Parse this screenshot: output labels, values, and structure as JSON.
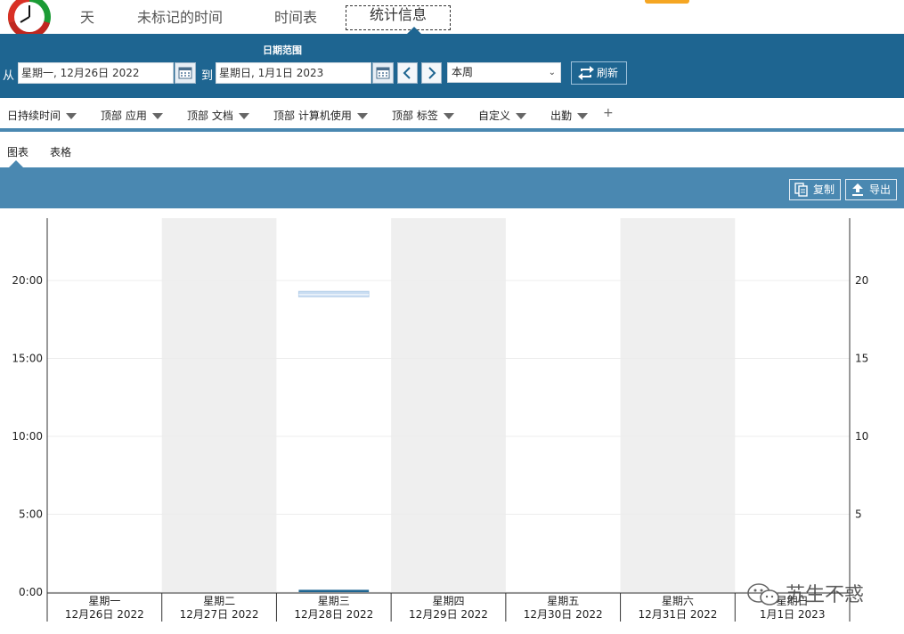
{
  "top_tabs": [
    {
      "label": "天"
    },
    {
      "label": "未标记的时间"
    },
    {
      "label": "时间表"
    },
    {
      "label": "统计信息",
      "active": true
    }
  ],
  "range": {
    "title": "日期范围",
    "from_label": "从",
    "from_value": "星期一, 12月26日 2022",
    "to_label": "到",
    "to_value": "星期日, 1月1日 2023",
    "period": "本周",
    "refresh_label": "刷新"
  },
  "report_tabs": [
    {
      "label": "日持续时间"
    },
    {
      "label": "顶部 应用"
    },
    {
      "label": "顶部 文档"
    },
    {
      "label": "顶部 计算机使用"
    },
    {
      "label": "顶部 标签"
    },
    {
      "label": "自定义"
    },
    {
      "label": "出勤"
    }
  ],
  "view_tabs": [
    {
      "label": "图表",
      "active": true
    },
    {
      "label": "表格"
    }
  ],
  "toolbar": {
    "copy_label": "复制",
    "export_label": "导出"
  },
  "watermark": "苏生不惑",
  "chart_data": {
    "type": "bar",
    "categories": [
      {
        "day": "星期一",
        "date": "12月26日 2022"
      },
      {
        "day": "星期二",
        "date": "12月27日 2022"
      },
      {
        "day": "星期三",
        "date": "12月28日 2022"
      },
      {
        "day": "星期四",
        "date": "12月29日 2022"
      },
      {
        "day": "星期五",
        "date": "12月30日 2022"
      },
      {
        "day": "星期六",
        "date": "12月31日 2022"
      },
      {
        "day": "星期日",
        "date": "1月1日 2023"
      }
    ],
    "left_axis": {
      "ticks": [
        "0:00",
        "5:00",
        "10:00",
        "15:00",
        "20:00"
      ],
      "values": [
        0,
        5,
        10,
        15,
        20
      ],
      "ylim": [
        0,
        24
      ]
    },
    "right_axis": {
      "ticks": [
        "5",
        "10",
        "15",
        "20"
      ],
      "values": [
        5,
        10,
        15,
        20
      ],
      "ylim": [
        0,
        24
      ]
    },
    "duration_hours": [
      0,
      0,
      0.15,
      0,
      0,
      0,
      0
    ],
    "range_marker": {
      "category_index": 2,
      "from_hours": 19.0,
      "to_hours": 19.3
    },
    "shaded_categories": [
      1,
      3,
      5
    ],
    "colors": {
      "bar": "#1e6591",
      "marker": "#c9ddf2",
      "shade": "#efefef",
      "grid": "#ececec"
    }
  }
}
